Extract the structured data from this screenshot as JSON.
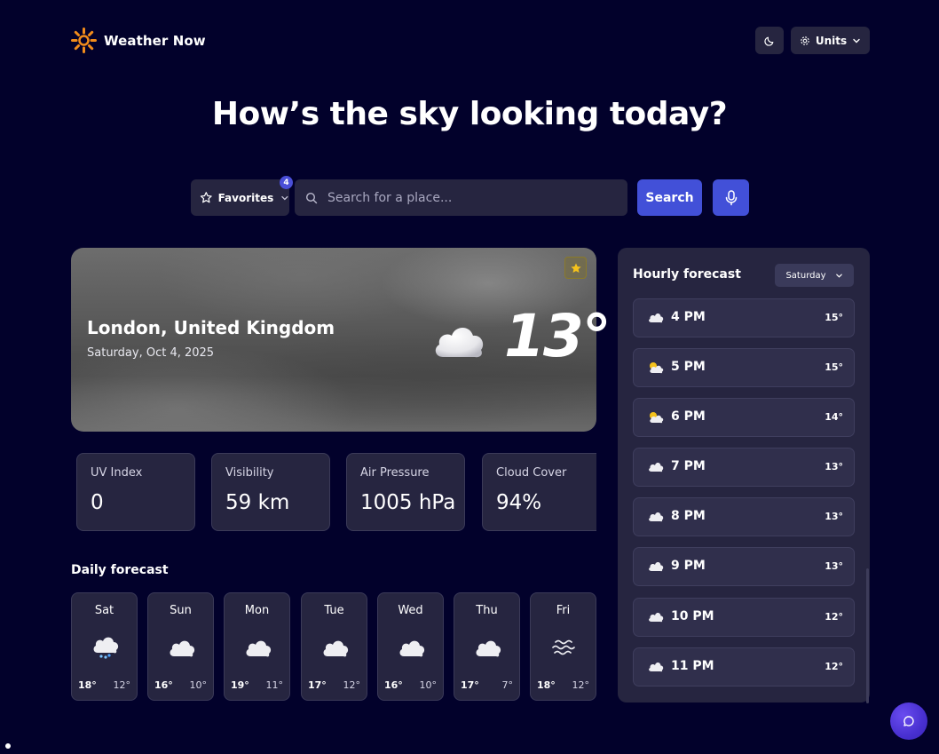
{
  "app": {
    "name": "Weather Now",
    "logo_icon": "sun-icon"
  },
  "header": {
    "theme_icon": "moon-icon",
    "units_label": "Units",
    "units_icon": "gear-icon"
  },
  "headline": "How’s the sky looking today?",
  "search": {
    "favorites_label": "Favorites",
    "favorites_count": "4",
    "placeholder": "Search for a place...",
    "value": "",
    "button_label": "Search",
    "mic_icon": "microphone-icon"
  },
  "current": {
    "city": "London, United Kingdom",
    "date": "Saturday, Oct 4, 2025",
    "temperature": "13°",
    "condition_icon": "cloud-icon",
    "favorited": true
  },
  "stats": [
    {
      "label": "UV Index",
      "value": "0"
    },
    {
      "label": "Visibility",
      "value": "59 km"
    },
    {
      "label": "Air Pressure",
      "value": "1005 hPa"
    },
    {
      "label": "Cloud Cover",
      "value": "94%"
    }
  ],
  "daily": {
    "title": "Daily forecast",
    "days": [
      {
        "day": "Sat",
        "icon": "snow-cloud-icon",
        "high": "18°",
        "low": "12°"
      },
      {
        "day": "Sun",
        "icon": "cloud-icon",
        "high": "16°",
        "low": "10°"
      },
      {
        "day": "Mon",
        "icon": "cloud-icon",
        "high": "19°",
        "low": "11°"
      },
      {
        "day": "Tue",
        "icon": "cloud-icon",
        "high": "17°",
        "low": "12°"
      },
      {
        "day": "Wed",
        "icon": "cloud-icon",
        "high": "16°",
        "low": "10°"
      },
      {
        "day": "Thu",
        "icon": "cloud-icon",
        "high": "17°",
        "low": "7°"
      },
      {
        "day": "Fri",
        "icon": "fog-icon",
        "high": "18°",
        "low": "12°"
      }
    ]
  },
  "hourly": {
    "title": "Hourly forecast",
    "selected_day": "Saturday",
    "hours": [
      {
        "time": "4 PM",
        "icon": "cloud-icon",
        "temp": "15°"
      },
      {
        "time": "5 PM",
        "icon": "partly-cloudy-icon",
        "temp": "15°"
      },
      {
        "time": "6 PM",
        "icon": "partly-cloudy-icon",
        "temp": "14°"
      },
      {
        "time": "7 PM",
        "icon": "cloud-icon",
        "temp": "13°"
      },
      {
        "time": "8 PM",
        "icon": "cloud-icon",
        "temp": "13°"
      },
      {
        "time": "9 PM",
        "icon": "cloud-icon",
        "temp": "13°"
      },
      {
        "time": "10 PM",
        "icon": "cloud-icon",
        "temp": "12°"
      },
      {
        "time": "11 PM",
        "icon": "cloud-icon",
        "temp": "12°"
      }
    ]
  },
  "chat_icon": "chat-bubble-icon",
  "colors": {
    "background": "#02012b",
    "card": "#262540",
    "accent": "#4250d8",
    "logo": "#f28c1b"
  }
}
